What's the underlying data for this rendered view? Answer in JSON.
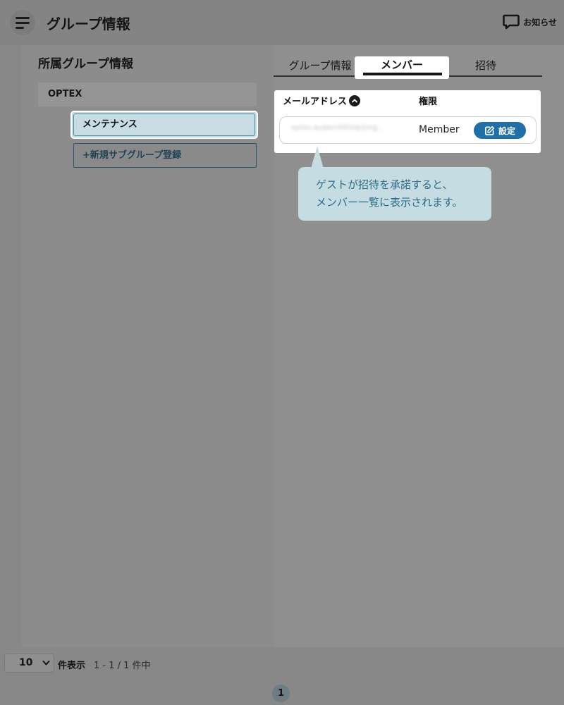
{
  "header": {
    "title": "グループ情報",
    "menu_icon": "hamburger-icon",
    "notice_label": "お知らせ",
    "notice_icon": "message-icon"
  },
  "sidebar": {
    "title": "所属グループ情報",
    "group_name": "OPTEX",
    "subgroups": [
      {
        "label": "メンテナンス",
        "selected": true
      }
    ],
    "add_subgroup_label": "+新規サブグループ登録"
  },
  "tabs": [
    {
      "label": "グループ情報",
      "active": false
    },
    {
      "label": "メンバー",
      "active": true
    },
    {
      "label": "招待",
      "active": false
    }
  ],
  "members_table": {
    "columns": {
      "email": "メールアドレス",
      "role": "権限"
    },
    "sort_icon": "chevron-up-icon",
    "rows": [
      {
        "email": "optex.audarcttthelp2org...",
        "role": "Member",
        "action_label": "設定",
        "action_icon": "edit-icon"
      }
    ]
  },
  "tooltip": {
    "line1": "ゲストが招待を承諾すると、",
    "line2": "メンバー一覧に表示されます。"
  },
  "pagination": {
    "per_page": "10",
    "per_page_label": "件表示",
    "range_text": "1 - 1 / 1 件中",
    "current_page": "1"
  },
  "colors": {
    "accent": "#1f6fa8",
    "tooltip_bg": "#c6dce3",
    "tooltip_text": "#2b6c88",
    "selected_bg": "#c8dde3"
  }
}
